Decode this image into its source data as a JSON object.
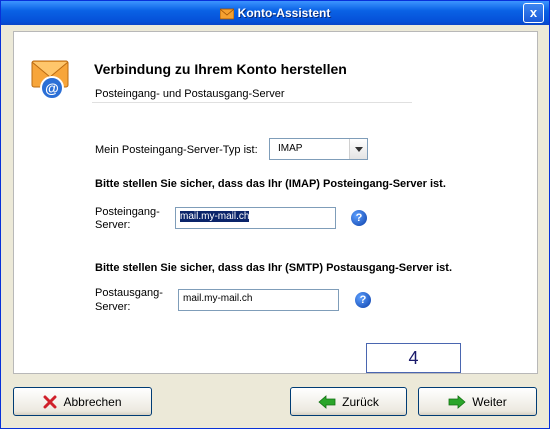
{
  "window": {
    "title": "Konto-Assistent",
    "close_glyph": "x"
  },
  "header": {
    "title": "Verbindung zu Ihrem Konto herstellen",
    "subtitle": "Posteingang- und Postausgang-Server",
    "icon": "mail-envelope-icon"
  },
  "form": {
    "server_type_label": "Mein Posteingang-Server-Typ ist:",
    "server_type_value": "IMAP",
    "incoming_instruction": "Bitte stellen Sie sicher, dass das Ihr (IMAP) Posteingang-Server ist.",
    "incoming_label_line1": "Posteingang-",
    "incoming_label_line2": "Server:",
    "incoming_value": "mail.my-mail.ch",
    "outgoing_instruction": "Bitte stellen Sie sicher, dass das Ihr (SMTP) Postausgang-Server ist.",
    "outgoing_label_line1": "Postausgang-",
    "outgoing_label_line2": "Server:",
    "outgoing_value": "mail.my-mail.ch",
    "help_glyph": "?"
  },
  "step": {
    "number": "4"
  },
  "buttons": {
    "cancel": "Abbrechen",
    "back": "Zurück",
    "next": "Weiter"
  },
  "colors": {
    "title_bar": "#0a62e5",
    "accent_green": "#2aa52a",
    "cancel_red": "#d0202a"
  }
}
